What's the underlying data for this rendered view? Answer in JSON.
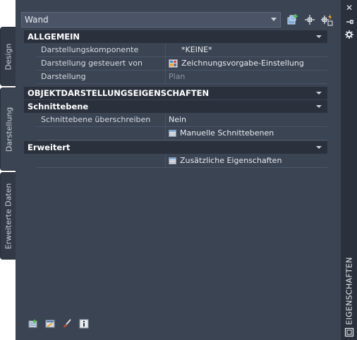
{
  "tabs": [
    {
      "label": "Design"
    },
    {
      "label": "Darstellung"
    },
    {
      "label": "Erweiterte Daten"
    }
  ],
  "palette_title": "EIGENSCHAFTEN",
  "object_selector": {
    "value": "Wand"
  },
  "sections": {
    "allgemein": {
      "title": "ALLGEMEIN",
      "rows": [
        {
          "name": "Darstellungskomponente",
          "value": "*KEINE*"
        },
        {
          "name": "Darstellung gesteuert von",
          "value": "Zeichnungsvorgabe-Einstellung"
        },
        {
          "name": "Darstellung",
          "value": "Plan"
        }
      ]
    },
    "objekt": {
      "title": "OBJEKTDARSTELLUNGSEIGENSCHAFTEN"
    },
    "schnittebene": {
      "title": "Schnittebene",
      "rows": [
        {
          "name": "Schnittebene überschreiben",
          "value": "Nein"
        },
        {
          "name": "",
          "value": "Manuelle Schnittebenen"
        }
      ]
    },
    "erweitert": {
      "title": "Erweitert",
      "rows": [
        {
          "name": "",
          "value": "Zusätzliche Eigenschaften"
        }
      ]
    }
  },
  "colors": {
    "panel": "#3b4453",
    "header": "#2a313c",
    "accent": "#f0a030"
  },
  "icons": [
    "close-icon",
    "pin-icon",
    "settings-icon",
    "add-selection-icon",
    "quick-select-icon",
    "select-objects-icon",
    "quick-properties-icon",
    "display-manager-icon",
    "brush-icon",
    "info-icon"
  ]
}
